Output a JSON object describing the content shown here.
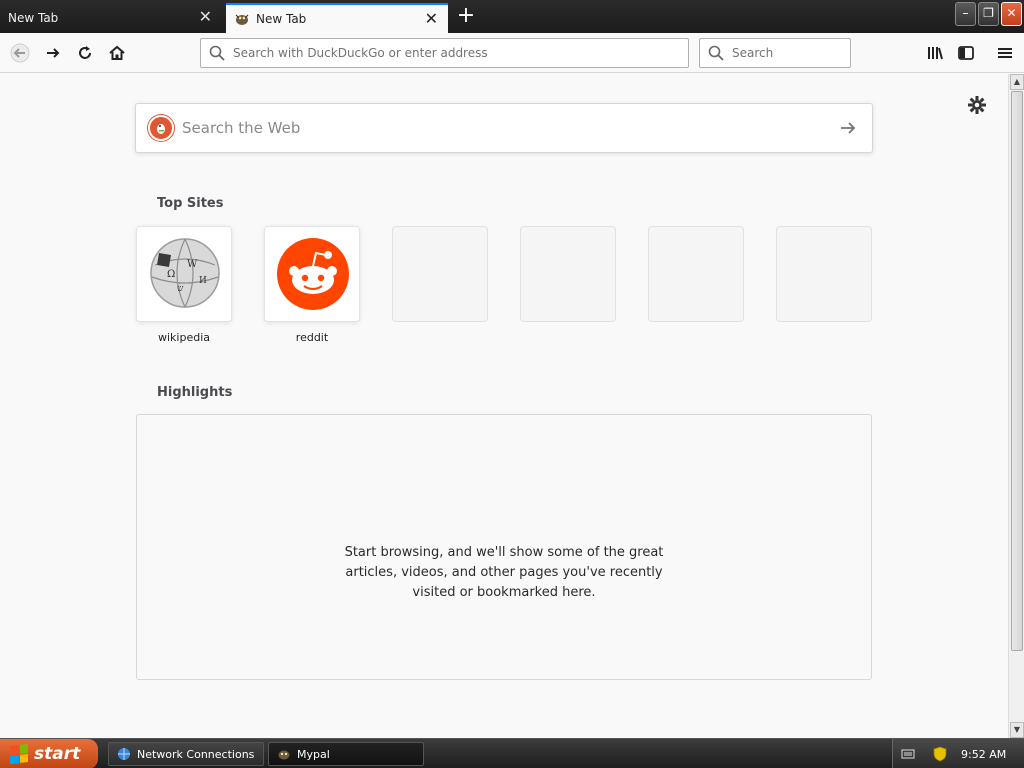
{
  "tabs": [
    {
      "title": "New Tab",
      "active": false
    },
    {
      "title": "New Tab",
      "active": true
    }
  ],
  "window_controls": {
    "minimize": "–",
    "restore": "❐",
    "close": "✕"
  },
  "urlbar": {
    "placeholder": "Search with DuckDuckGo or enter address"
  },
  "searchbar": {
    "placeholder": "Search"
  },
  "newtab_page": {
    "web_search_placeholder": "Search the Web",
    "top_sites_title": "Top Sites",
    "top_sites": [
      {
        "label": "wikipedia"
      },
      {
        "label": "reddit"
      },
      {
        "label": ""
      },
      {
        "label": ""
      },
      {
        "label": ""
      },
      {
        "label": ""
      }
    ],
    "highlights_title": "Highlights",
    "highlights_message": "Start browsing, and we'll show some of the great articles, videos, and other pages you've recently visited or bookmarked here."
  },
  "taskbar": {
    "start_label": "start",
    "tasks": [
      {
        "label": "Network Connections"
      },
      {
        "label": "Mypal"
      }
    ],
    "clock": "9:52 AM"
  },
  "colors": {
    "accent": "#0a84ff",
    "reddit": "#ff4500",
    "duckduckgo": "#de5833",
    "start_button": "#d3541f"
  }
}
